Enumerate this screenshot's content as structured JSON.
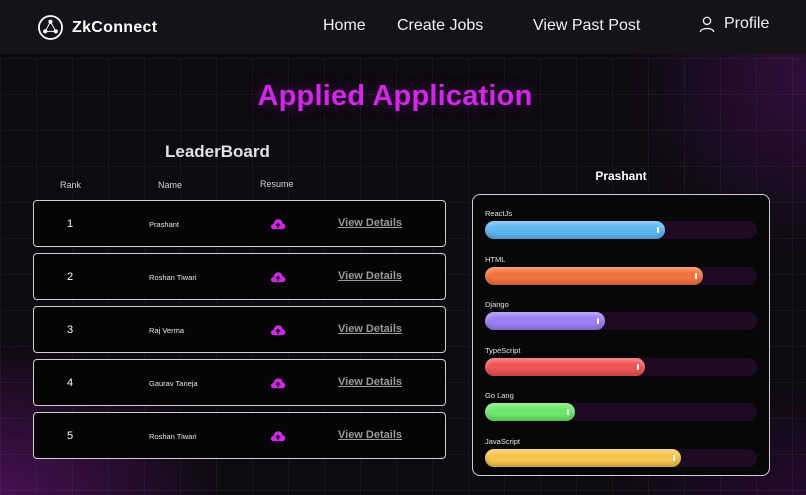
{
  "nav": {
    "brand": "ZkConnect",
    "links": [
      {
        "label": "Home"
      },
      {
        "label": "Create Jobs"
      },
      {
        "label": "View Past Post"
      }
    ],
    "profile_label": "Profile"
  },
  "page_title": "Applied Application",
  "leaderboard": {
    "title": "LeaderBoard",
    "columns": {
      "rank": "Rank",
      "name": "Name",
      "resume": "Resume"
    },
    "details_label": "View Details",
    "rows": [
      {
        "rank": "1",
        "name": "Prashant"
      },
      {
        "rank": "2",
        "name": "Roshan Tiwari"
      },
      {
        "rank": "3",
        "name": "Raj Verma"
      },
      {
        "rank": "4",
        "name": "Gaurav Taneja"
      },
      {
        "rank": "5",
        "name": "Roshan Tiwari"
      }
    ]
  },
  "skills_panel": {
    "candidate": "Prashant",
    "skills": [
      {
        "label": "ReactJs",
        "percent": 66,
        "color": "#5cb8f2"
      },
      {
        "label": "HTML",
        "percent": 80,
        "color": "#f1733f"
      },
      {
        "label": "Django",
        "percent": 44,
        "color": "#9b7ff2"
      },
      {
        "label": "TypeScript",
        "percent": 59,
        "color": "#f05454"
      },
      {
        "label": "Go Lang",
        "percent": 33,
        "color": "#6ee86a"
      },
      {
        "label": "JavaScript",
        "percent": 72,
        "color": "#f7c44e"
      }
    ]
  },
  "colors": {
    "accent": "#cf29e6",
    "background": "#0d0a10"
  }
}
